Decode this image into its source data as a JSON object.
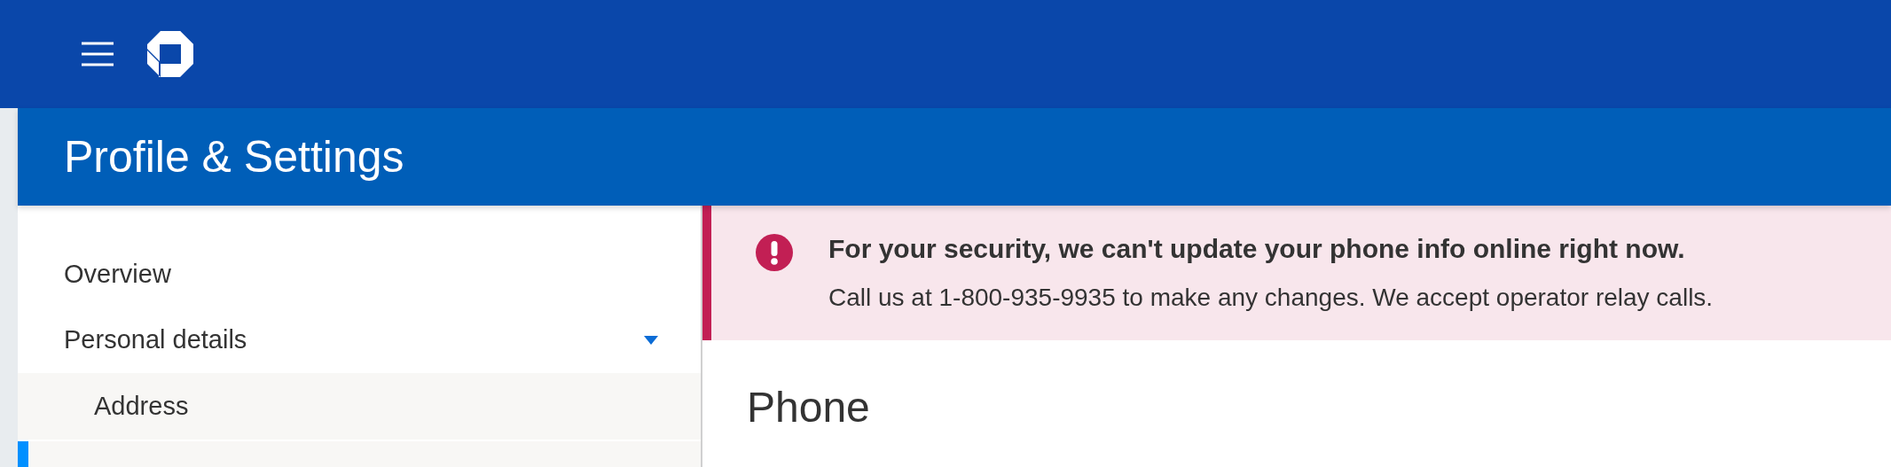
{
  "header": {
    "title": "Profile & Settings"
  },
  "sidebar": {
    "items": [
      {
        "label": "Overview"
      },
      {
        "label": "Personal details",
        "expanded": true,
        "children": [
          {
            "label": "Address",
            "selected": false
          }
        ]
      }
    ]
  },
  "alert": {
    "title": "For your security, we can't update your phone info online right now.",
    "message": "Call us at 1-800-935-9935 to make any changes. We accept operator relay calls."
  },
  "section": {
    "title": "Phone"
  }
}
